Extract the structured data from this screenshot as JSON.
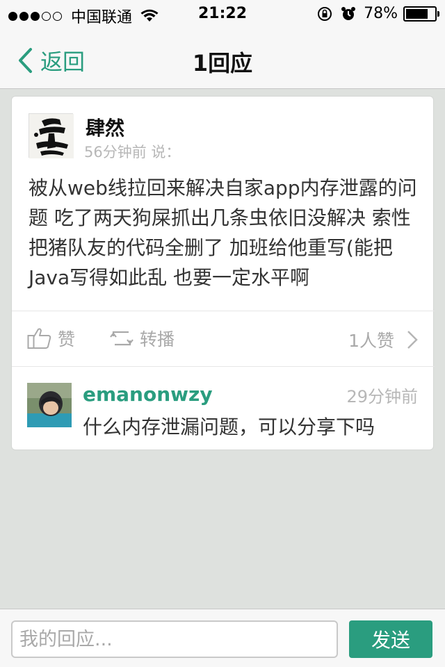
{
  "status_bar": {
    "carrier": "中国联通",
    "signal_bars_filled": 3,
    "signal_bars_total": 5,
    "time": "21:22",
    "battery": "78%",
    "battery_level": 0.78
  },
  "nav": {
    "back_label": "返回",
    "title": "1回应"
  },
  "post": {
    "author": "肆然",
    "meta": "56分钟前 说：",
    "text": "被从web线拉回来解决自家app内存泄露的问题 吃了两天狗屎抓出几条虫依旧没解决 索性把猪队友的代码全删了 加班给他重写(能把Java写得如此乱 也要一定水平啊",
    "actions": {
      "like_label": "赞",
      "repost_label": "转播",
      "likes_count_label": "1人赞"
    }
  },
  "reply": {
    "author": "emanonwzy",
    "time": "29分钟前",
    "text": "什么内存泄漏问题，可以分享下吗"
  },
  "composer": {
    "placeholder": "我的回应...",
    "send_label": "发送"
  },
  "colors": {
    "accent": "#2a9d7f",
    "background": "#dee1de"
  }
}
